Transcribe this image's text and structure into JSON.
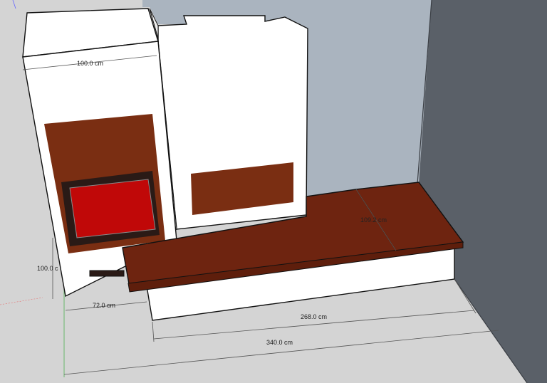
{
  "scene": {
    "colors": {
      "floor": "#d4d4d4",
      "back_wall": "#aab4bf",
      "side_wall": "#5a6068",
      "stove_body": "#ffffff",
      "stove_side": "#efefef",
      "brown_panel": "#7a2e12",
      "bench_top": "#6e2410",
      "bench_front": "#5e1e0c",
      "fire_door_frame": "#2a1a16",
      "fire_door_glass": "#c00808",
      "outline": "#111111"
    },
    "dimensions": {
      "stove_width": "100.0 cm",
      "stove_height": "100.0 c",
      "stove_depth": "72.0 cm",
      "bench_depth": "109.2 cm",
      "bench_length": "268.0 cm",
      "total_length": "340.0 cm"
    }
  }
}
